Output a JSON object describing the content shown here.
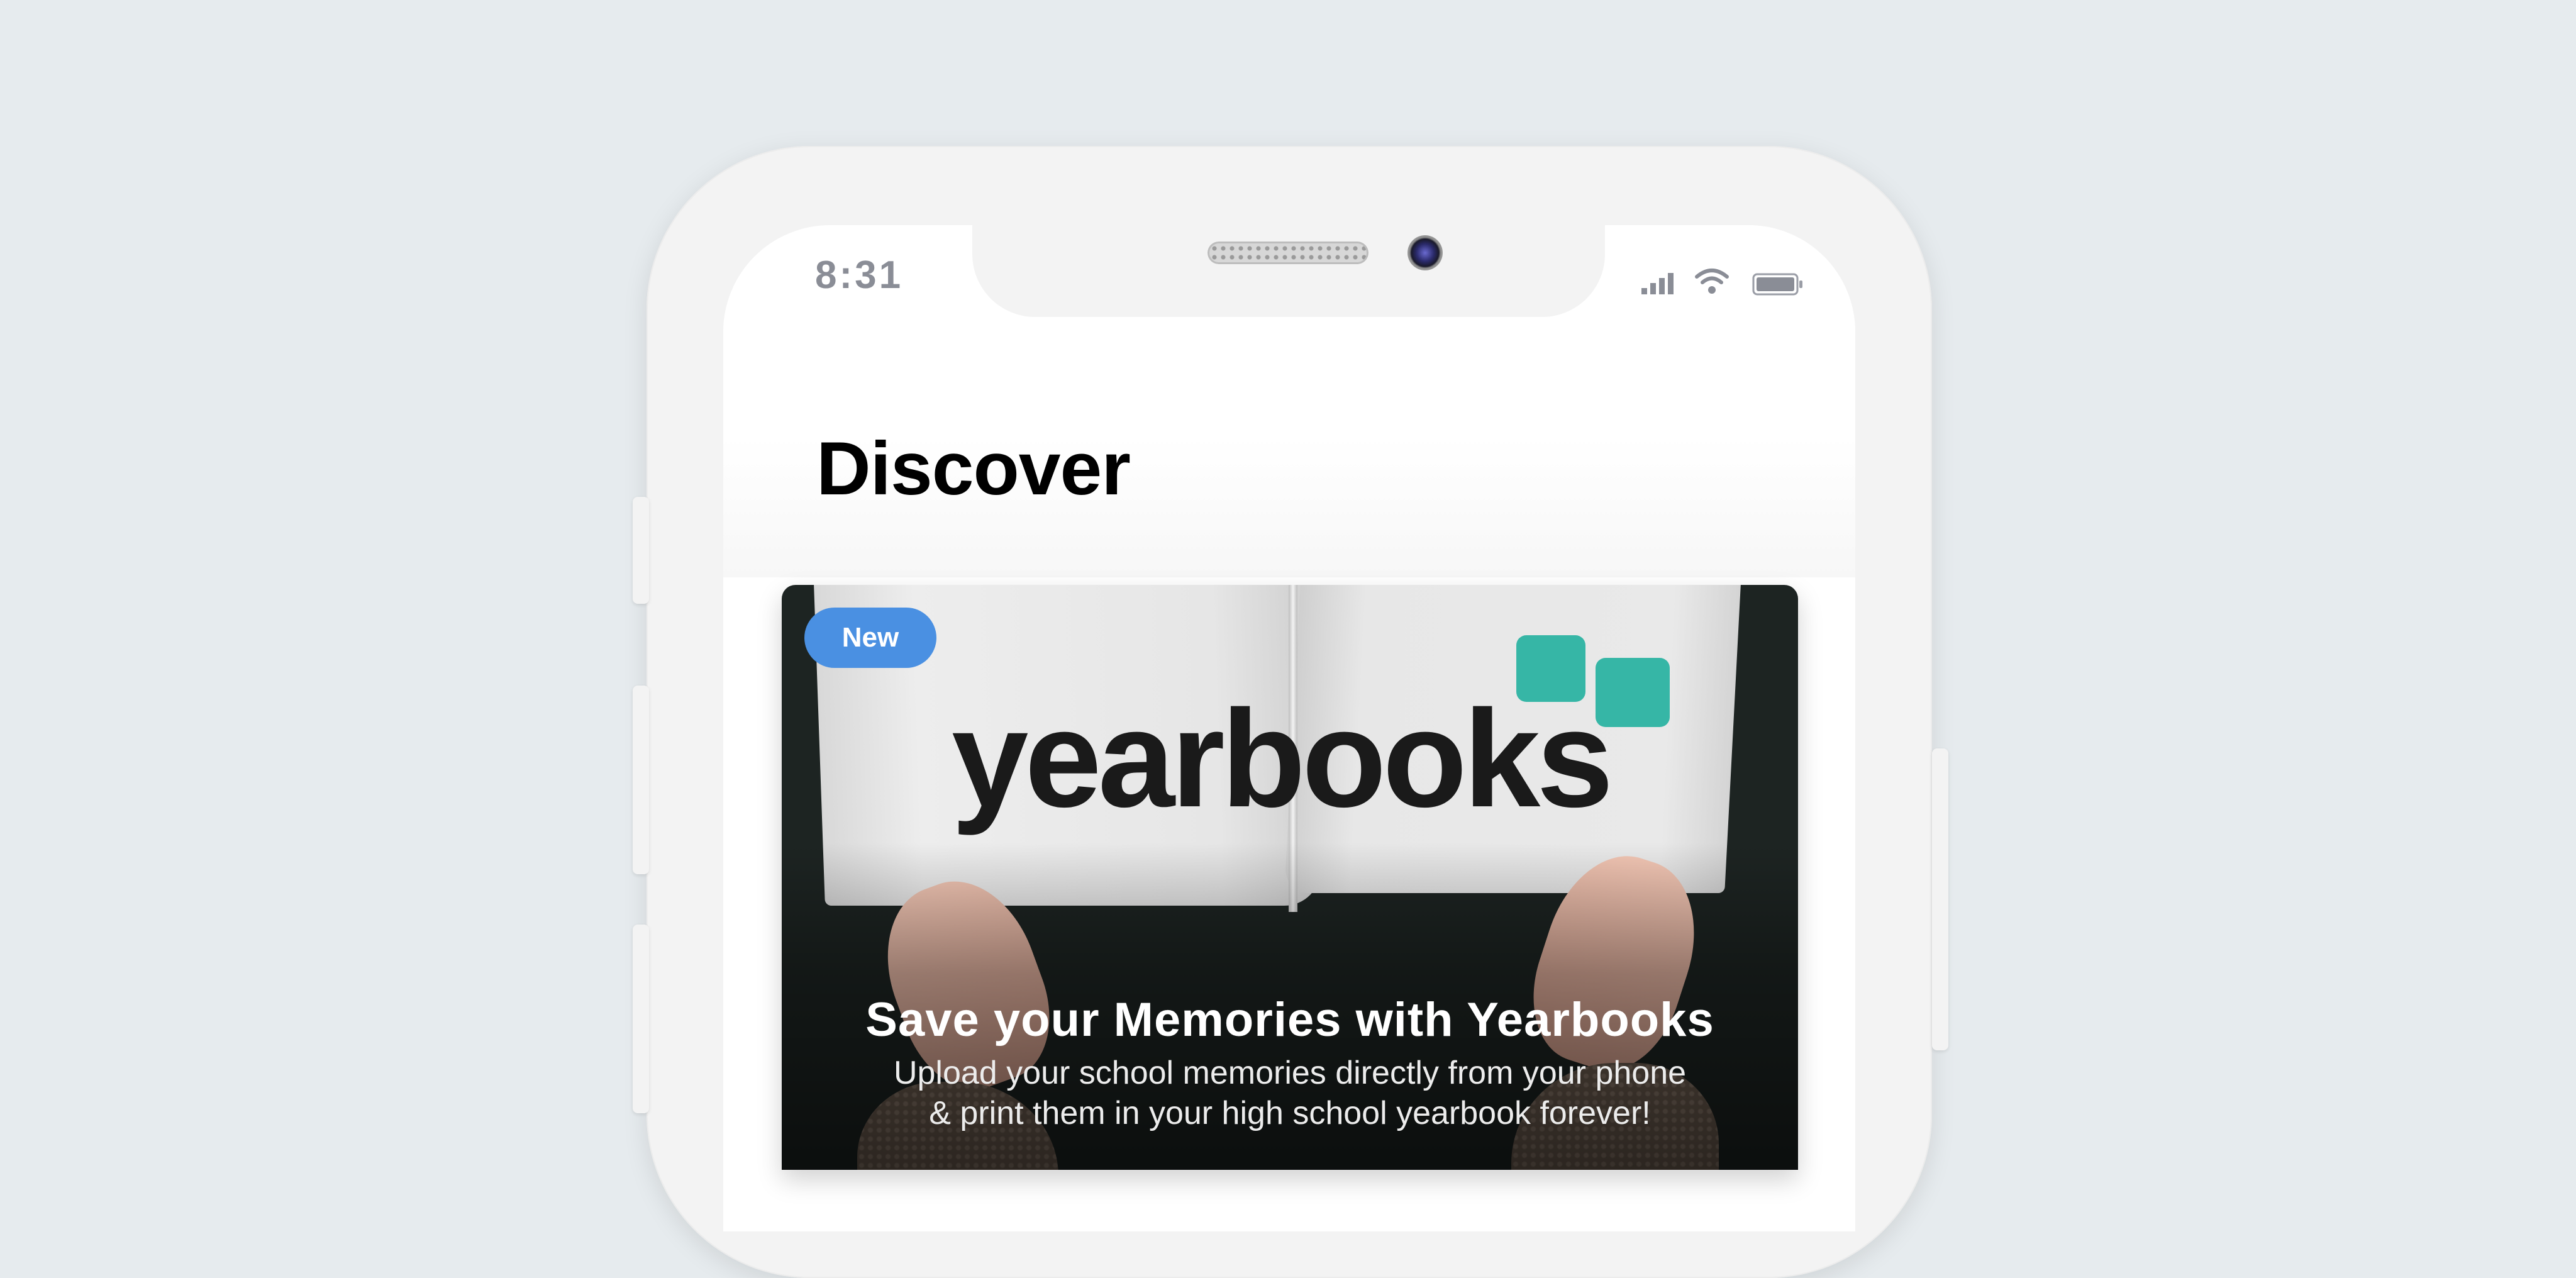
{
  "status_bar": {
    "time": "8:31",
    "icons": [
      "cellular-signal-icon",
      "wifi-icon",
      "battery-icon"
    ]
  },
  "page": {
    "title": "Discover"
  },
  "card": {
    "badge": "New",
    "logo_text": "yearbooks",
    "title": "Save your Memories with Yearbooks",
    "description_line1": "Upload your school memories directly from your phone",
    "description_line2": "& print them in your high school yearbook forever!"
  },
  "colors": {
    "badge": "#4a90e2",
    "logo_accent": "#36b6a6",
    "background": "#e6ebee"
  }
}
